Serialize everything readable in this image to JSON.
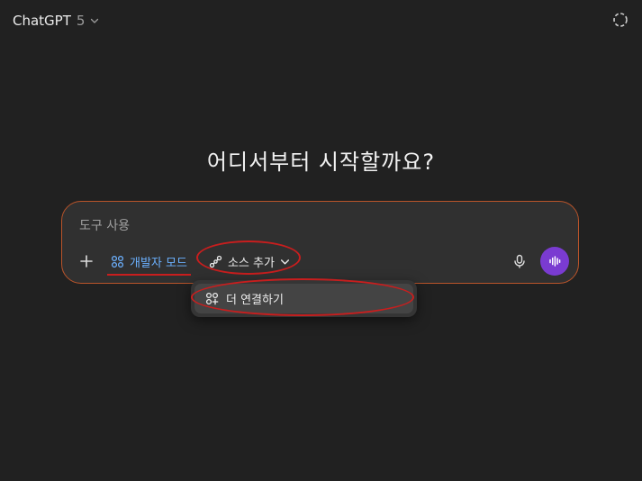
{
  "header": {
    "model_name": "ChatGPT",
    "model_version": "5",
    "temp_chat_icon": "dashed-circle-icon"
  },
  "main": {
    "headline": "어디서부터 시작할까요?"
  },
  "composer": {
    "input_placeholder": "도구 사용",
    "dev_mode_label": "개발자 모드",
    "source_add_label": "소스 추가",
    "accent_border": "#b9542a",
    "voice_button_color": "#7a3bd1"
  },
  "dropdown": {
    "items": [
      {
        "label": "더 연결하기",
        "icon": "apps-plus-icon"
      }
    ]
  },
  "colors": {
    "background": "#212121",
    "link_blue": "#6cb1ff",
    "annotation_red": "#c81e1e"
  }
}
